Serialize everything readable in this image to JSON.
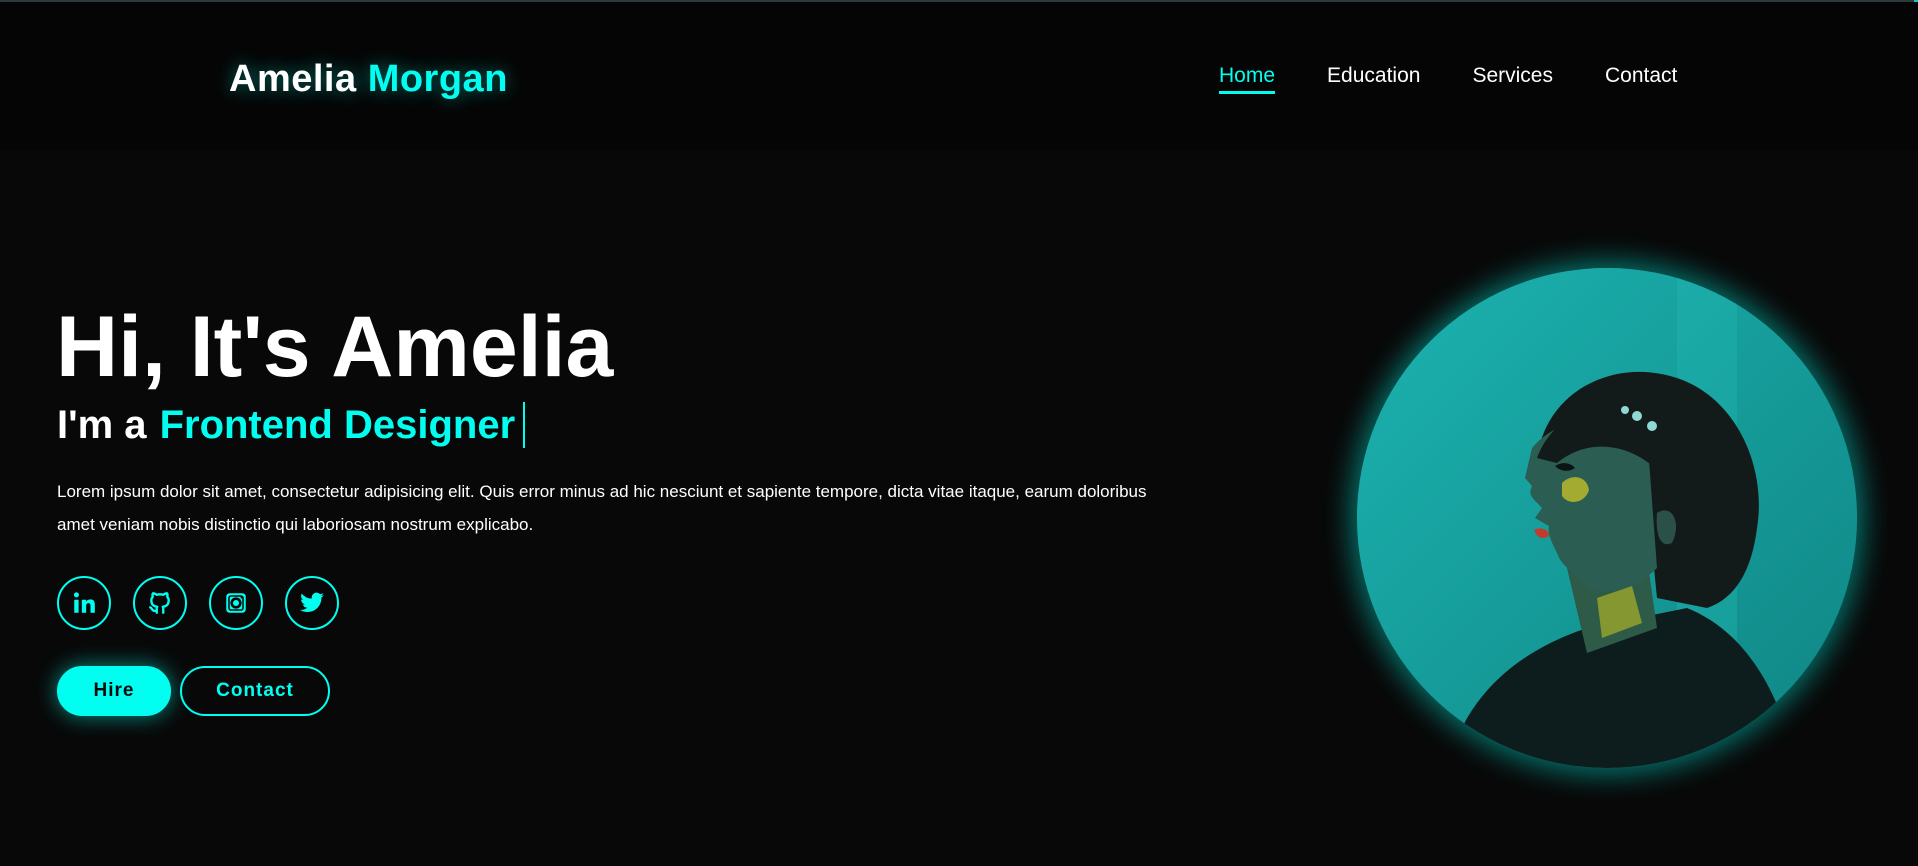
{
  "logo": {
    "first": "Amelia",
    "last": "Morgan"
  },
  "nav": {
    "home": "Home",
    "education": "Education",
    "services": "Services",
    "contact": "Contact"
  },
  "hero": {
    "title": "Hi, It's Amelia",
    "sub_prefix": "I'm a",
    "role": "Frontend Designer",
    "description": "Lorem ipsum dolor sit amet, consectetur adipisicing elit. Quis error minus ad hic nesciunt et sapiente tempore, dicta vitae itaque, earum doloribus amet veniam nobis distinctio qui laboriosam nostrum explicabo.",
    "hire_label": "Hire",
    "contact_label": "Contact"
  },
  "socials": [
    "linkedin-icon",
    "github-icon",
    "instagram-icon",
    "twitter-icon"
  ],
  "colors": {
    "accent": "#00fff0",
    "background": "#080808",
    "header": "#050505"
  }
}
